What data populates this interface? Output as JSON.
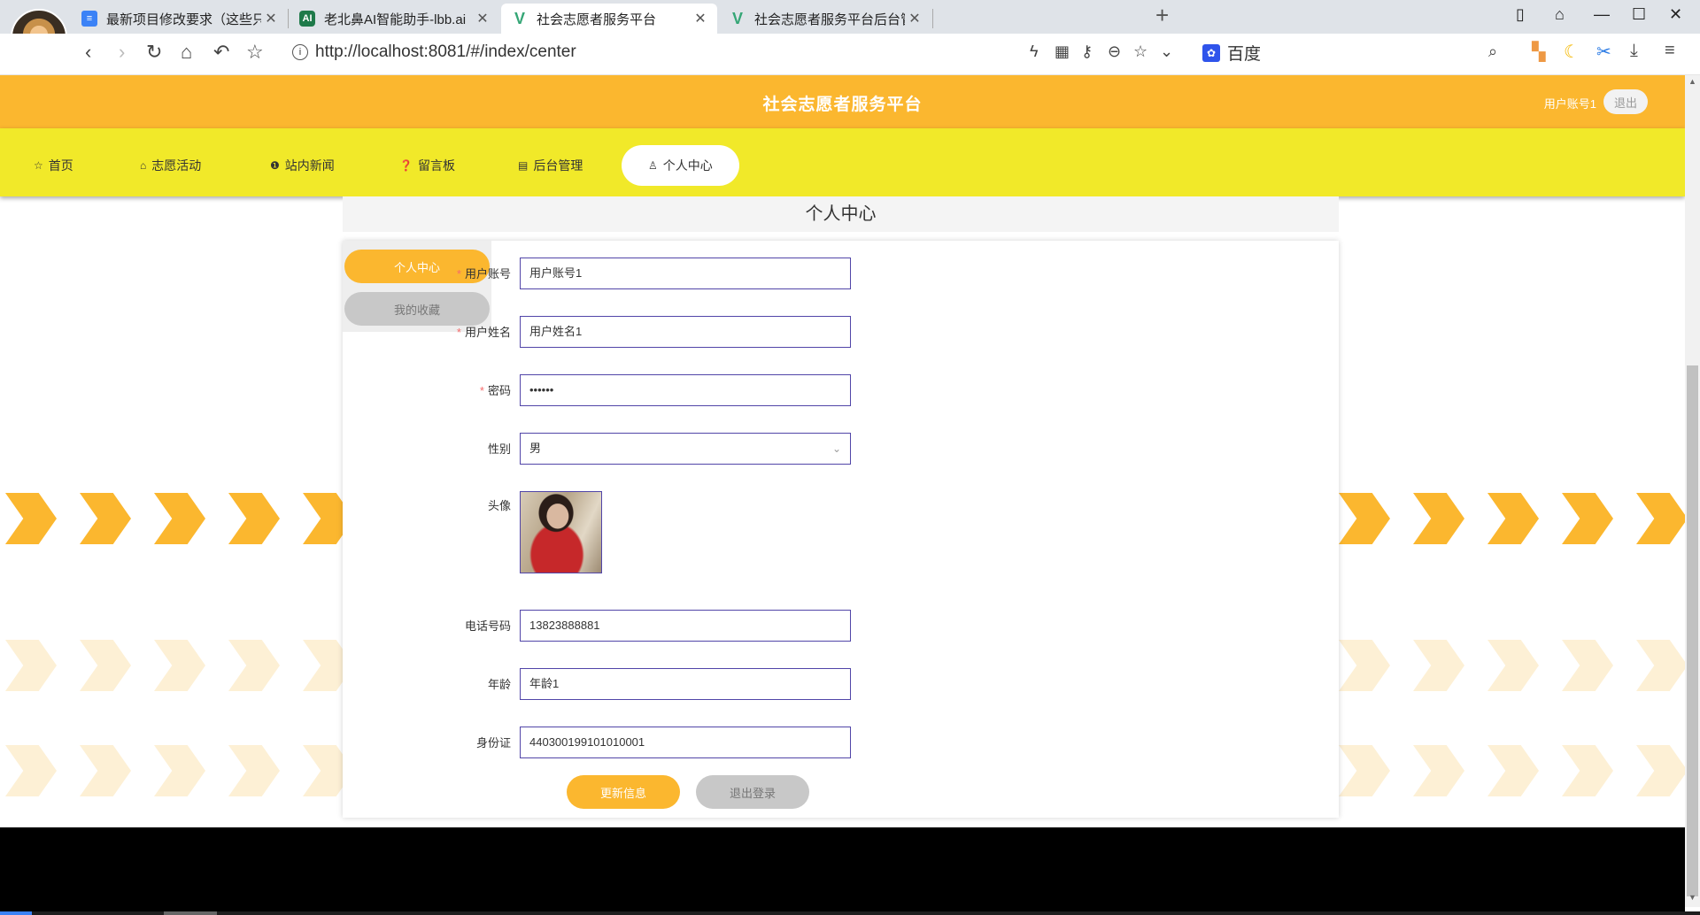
{
  "browser": {
    "tabs": [
      {
        "title": "最新项目修改要求（这些只是通用",
        "icon": "doc-icon",
        "active": false
      },
      {
        "title": "老北鼻AI智能助手-lbb.ai",
        "icon": "ai-icon",
        "active": false
      },
      {
        "title": "社会志愿者服务平台",
        "icon": "vue-icon",
        "active": true
      },
      {
        "title": "社会志愿者服务平台后台管理系统",
        "icon": "vue-icon",
        "active": false
      }
    ],
    "url": "http://localhost:8081/#/index/center",
    "search_engine": "百度"
  },
  "header": {
    "title": "社会志愿者服务平台",
    "user": "用户账号1",
    "logout": "退出",
    "accent_color": "#fbb72f",
    "nav_color": "#f1e929"
  },
  "nav": [
    {
      "label": "首页",
      "icon": "star-icon"
    },
    {
      "label": "志愿活动",
      "icon": "bag-icon"
    },
    {
      "label": "站内新闻",
      "icon": "info-icon"
    },
    {
      "label": "留言板",
      "icon": "question-icon"
    },
    {
      "label": "后台管理",
      "icon": "briefcase-icon"
    },
    {
      "label": "个人中心",
      "icon": "user-icon",
      "active": true
    }
  ],
  "page": {
    "title": "个人中心",
    "side": {
      "active": "个人中心",
      "other": "我的收藏"
    },
    "form": {
      "account_label": "用户账号",
      "account": "用户账号1",
      "name_label": "用户姓名",
      "name": "用户姓名1",
      "password_label": "密码",
      "password": "••••••",
      "gender_label": "性别",
      "gender": "男",
      "avatar_label": "头像",
      "phone_label": "电话号码",
      "phone": "13823888881",
      "age_label": "年龄",
      "age": "年龄1",
      "id_label": "身份证",
      "id_card": "440300199101010001"
    },
    "buttons": {
      "update": "更新信息",
      "logout": "退出登录"
    }
  }
}
